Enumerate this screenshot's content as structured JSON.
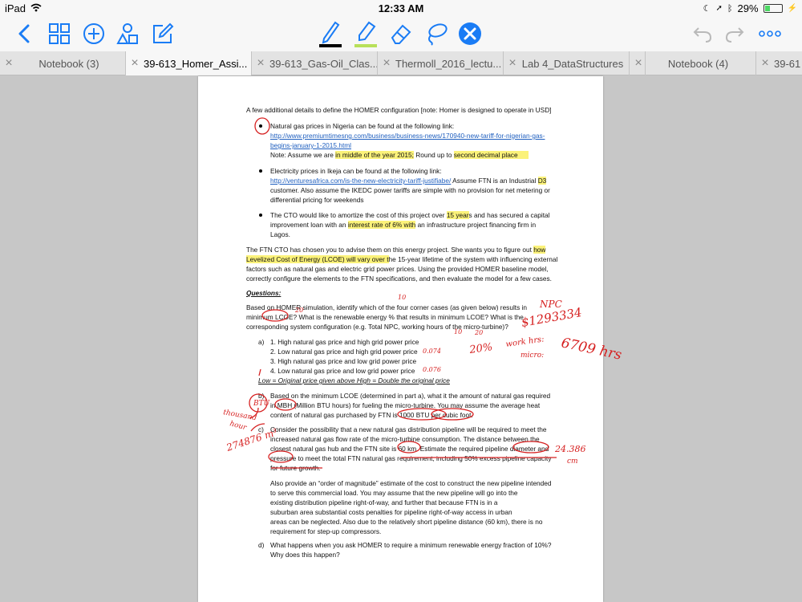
{
  "status": {
    "device": "iPad",
    "time": "12:33 AM",
    "battery": "29%"
  },
  "tabs": [
    {
      "label": "Notebook (3)"
    },
    {
      "label": "39-613_Homer_Assi..."
    },
    {
      "label": "39-613_Gas-Oil_Clas..."
    },
    {
      "label": "Thermoll_2016_lectu..."
    },
    {
      "label": "Lab 4_DataStructures"
    },
    {
      "label": ""
    },
    {
      "label": "Notebook (4)"
    },
    {
      "label": "39-61"
    }
  ],
  "colors": {
    "accent": "#1a7cf5",
    "highlight": "#fbf27a",
    "ink": "#d62020",
    "highlighter_swatch": "#b8e05a"
  },
  "doc": {
    "intro": "A few additional details to define the HOMER configuration [note: Homer is designed to operate in USD]",
    "b1_l1": "Natural gas prices in Nigeria can be found at the following link:",
    "b1_link1": "http://www.premiumtimesng.com/business/business-news/170940-new-tariff-for-nigerian-gas-",
    "b1_link2": "begins-january-1-2015.html",
    "b1_note_a": "Note: Assume we are ",
    "b1_note_hl1": "in middle of the year 2015;",
    "b1_note_b": " Round up to ",
    "b1_note_hl2": "second decimal place",
    "b2_l1": "Electricity prices in Ikeja can be found at the following link:",
    "b2_link": "http://venturesafrica.com/is-the-new-electricity-tariff-justifiabe/",
    "b2_a": "  Assume FTN is an Industrial ",
    "b2_hl": "D3",
    "b2_l3": "customer. Also assume the IKEDC power tariffs are simple with no provision for net metering or",
    "b2_l4": "differential pricing for weekends",
    "b3_l1a": "The CTO would like to amortize the cost of this project over ",
    "b3_l1hl": "15 year",
    "b3_l1b": "s and has secured a capital",
    "b3_l2a": "improvement loan with an ",
    "b3_l2hl": "interest rate of 6% with",
    "b3_l2b": " an infrastructure project financing firm in",
    "b3_l3": "Lagos.",
    "p1_l1a": "The FTN CTO has chosen you to advise them on this energy project. She wants you to figure out ",
    "p1_l1hl": "how",
    "p1_l2hl": "Levelized Cost of Energy (LCOE) will vary over t",
    "p1_l2b": "he 15-year lifetime of the system with influencing external",
    "p1_l3": "factors such as natural gas and electric grid power prices. Using the provided HOMER baseline model,",
    "p1_l4": "correctly configure the elements to the FTN specifications, and then evaluate the model for a few cases.",
    "questions": "Questions:",
    "q_l1": "Based on HOMER simulation, identify which of the four corner cases (as given below) results in",
    "q_l2": "minimum LCOE? What is the renewable energy % that results in minimum LCOE? What is the",
    "q_l3": "corresponding system configuration (e.g. Total NPC, working hours of the micro-turbine)?",
    "a_label": "a)",
    "a1": "1. High natural gas price and high grid power price",
    "a2": "2. Low natural gas price and high grid power price",
    "a3": "3. High natural gas price and low grid power price",
    "a4": "4. Low natural gas price and low grid power price",
    "a_note": "Low = Original price given above   High = Double the original price",
    "b_label": "b)",
    "b_l1": "Based on the minimum LCOE (determined in part a), what it the amount of natural gas required",
    "b_l2": "in MBH (Million BTU hours) for fueling the micro-turbine. You may assume the average heat",
    "b_l3": "content of natural gas purchased by FTN is 1000 BTU per cubic foot.",
    "c_label": "c)",
    "c_l1": "Consider the possibility that a new natural gas distribution pipeline will be required to meet the",
    "c_l2": "increased natural gas flow rate of the micro-turbine consumption. The distance between the",
    "c_l3": "closest natural gas hub and the FTN site is 60 km. Estimate the required pipeline diameter and",
    "c_l4": "pressure to meet the total FTN natural gas requirement, including 50% excess pipeline capacity",
    "c_l5": "for future growth.",
    "c2_l1": "Also provide an “order of magnitude” estimate of the cost to construct the new pipeline intended",
    "c2_l2": "to serve this commercial load. You may assume that the new pipeline will go into the",
    "c2_l3": "existing distribution pipeline right-of-way, and further that because FTN is in a",
    "c2_l4": "suburban area substantial costs penalties for pipeline right-of-way access in urban",
    "c2_l5": "areas can be neglected. Also due to the relatively short pipeline distance (60 km), there is no",
    "c2_l6": "requirement for step-up compressors.",
    "d_label": "d)",
    "d_l1": "What happens when you ask HOMER to require a minimum renewable energy fraction of 10%?",
    "d_l2": "Why does this happen?"
  },
  "annotations": {
    "npc_label": "NPC",
    "npc_value": "$1293334",
    "work_hrs": "work hrs:",
    "micro": "micro:",
    "hours_value": "6709 hrs",
    "pct": "20%",
    "v1": "0.074",
    "v2": "0.076",
    "n10": "10",
    "n10b": "10",
    "n20": "20",
    "n20b": "20",
    "thousand": "thousand",
    "hour": "hour",
    "btu": "BTU",
    "m3": "274876 m³",
    "cm": "24.386",
    "cm_unit": "cm"
  }
}
